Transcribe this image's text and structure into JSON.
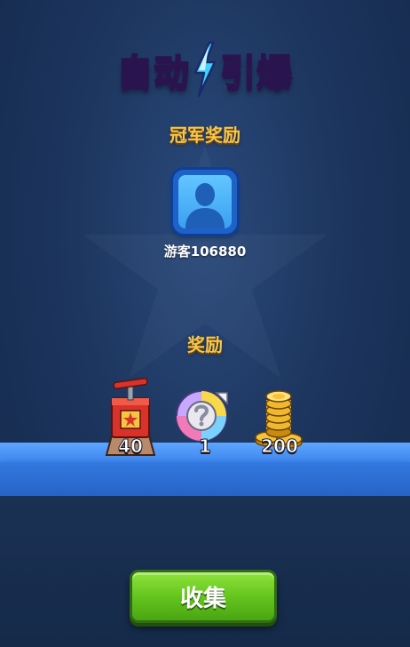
{
  "logo": {
    "text_left": "自动",
    "text_right": "引爆"
  },
  "champion": {
    "title": "冠军奖励",
    "player_name": "游客106880"
  },
  "rewards": {
    "title": "奖励",
    "items": [
      {
        "icon": "detonator-icon",
        "count": "40"
      },
      {
        "icon": "mystery-card-icon",
        "count": "1"
      },
      {
        "icon": "gold-coins-icon",
        "count": "200"
      }
    ]
  },
  "collect_button": {
    "label": "收集"
  },
  "colors": {
    "background": "#1d365f",
    "gold_title": "#f7c64a",
    "shelf": "#3d86ee",
    "button_green": "#62c21c",
    "avatar_blue": "#3aa0f0"
  }
}
